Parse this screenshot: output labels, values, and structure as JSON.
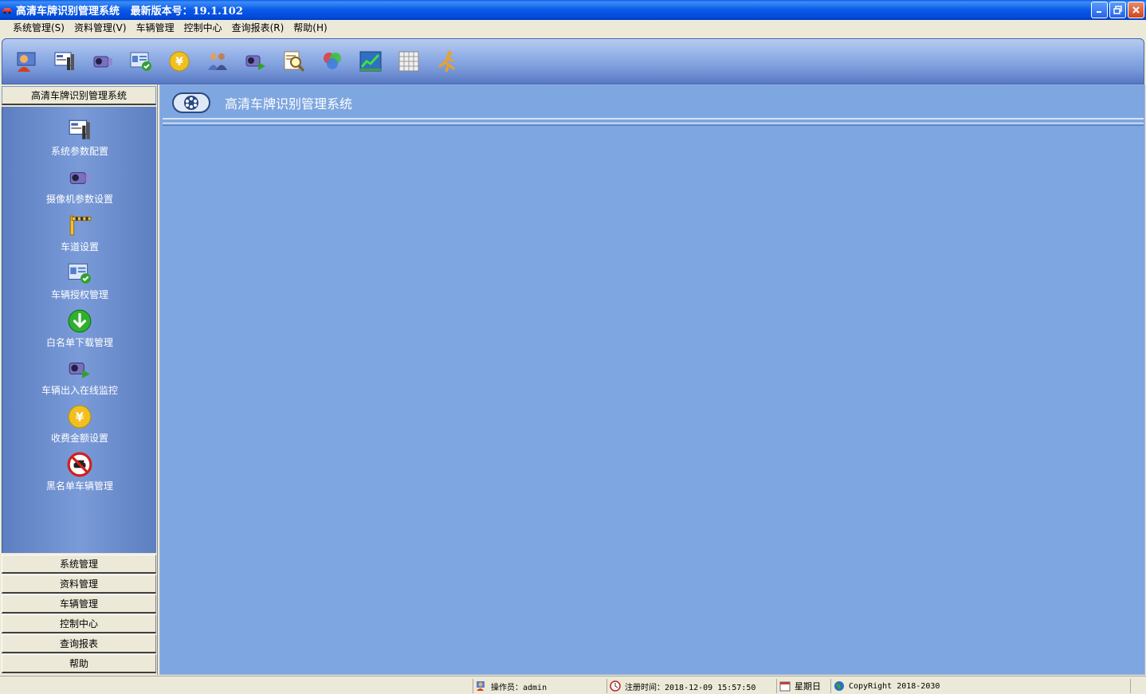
{
  "window": {
    "title": "高清车牌识别管理系统   最新版本号：19.1.102",
    "buttons": [
      "minimize-icon",
      "restore-icon",
      "close-icon"
    ]
  },
  "menu": [
    {
      "label": "系统管理(S)"
    },
    {
      "label": "资料管理(V)"
    },
    {
      "label": "车辆管理"
    },
    {
      "label": "控制中心"
    },
    {
      "label": "查询报表(R)"
    },
    {
      "label": "帮助(H)"
    }
  ],
  "toolbar": {
    "icons": [
      "user-icon",
      "system-config-icon",
      "camera-icon",
      "vehicle-auth-icon",
      "yen-coin-icon",
      "users-icon",
      "monitor-camera-icon",
      "search-report-icon",
      "color-circles-icon",
      "chart-icon",
      "grid-icon",
      "runner-exit-icon"
    ]
  },
  "sidebar": {
    "header": "高清车牌识别管理系统",
    "items": [
      {
        "label": "系统参数配置",
        "icon": "system-config-icon"
      },
      {
        "label": "摄像机参数设置",
        "icon": "camera-icon"
      },
      {
        "label": "车道设置",
        "icon": "barrier-gate-icon"
      },
      {
        "label": "车辆授权管理",
        "icon": "vehicle-auth-icon"
      },
      {
        "label": "白名单下载管理",
        "icon": "download-arrow-icon"
      },
      {
        "label": "车辆出入在线监控",
        "icon": "monitor-camera-icon"
      },
      {
        "label": "收费金额设置",
        "icon": "yen-coin-icon"
      },
      {
        "label": "黑名单车辆管理",
        "icon": "no-car-icon"
      }
    ],
    "categories": [
      {
        "label": "系统管理"
      },
      {
        "label": "资料管理"
      },
      {
        "label": "车辆管理"
      },
      {
        "label": "控制中心"
      },
      {
        "label": "查询报表"
      },
      {
        "label": "帮助"
      }
    ]
  },
  "main": {
    "title": "高清车牌识别管理系统"
  },
  "status": {
    "operator": "操作员：admin",
    "login_time": "注册时间：2018-12-09 15:57:50",
    "weekday": "星期日",
    "copyright": "CopyRight 2018-2030"
  },
  "colors": {
    "titlebar": "#0a5fe6",
    "panel": "#7a9bd8",
    "content": "#7ea6e0",
    "chrome": "#ece9d8"
  }
}
